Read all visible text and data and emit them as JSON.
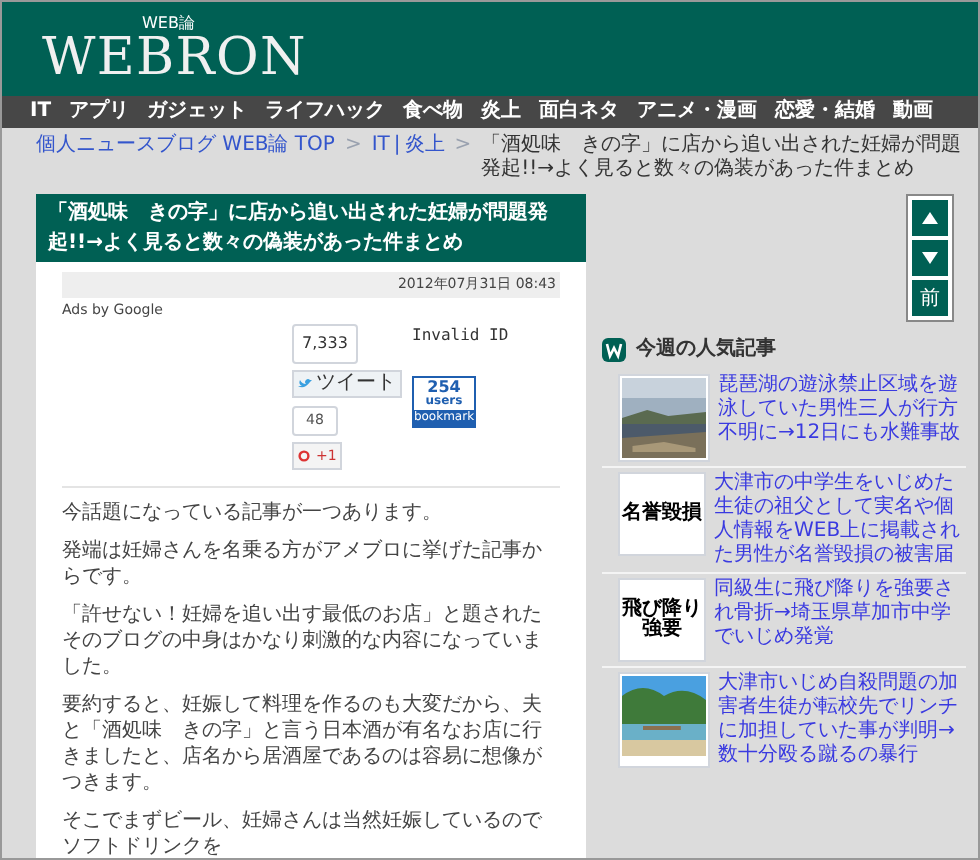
{
  "header": {
    "logo_small": "WEB論",
    "logo": "WEBRON"
  },
  "nav": [
    "IT",
    "アプリ",
    "ガジェット",
    "ライフハック",
    "食べ物",
    "炎上",
    "面白ネタ",
    "アニメ・漫画",
    "恋愛・結婚",
    "動画"
  ],
  "breadcrumb": {
    "home": "個人ニュースブログ WEB論 TOP",
    "sep": ">",
    "cat1": "IT",
    "bar": "|",
    "cat2": "炎上",
    "current": "「酒処味　きの字」に店から追い出された妊婦が問題発起!!→よく見ると数々の偽装があった件まとめ"
  },
  "article": {
    "title": "「酒処味　きの字」に店から追い出された妊婦が問題発起!!→よく見ると数々の偽装があった件まとめ",
    "date": "2012年07月31日 08:43",
    "ads": "Ads by Google",
    "share": {
      "tweet_count": "7,333",
      "tweet": "ツイート",
      "invalid": "Invalid ID",
      "plus_count": "48",
      "plus": "+1",
      "bookmark_count": "254",
      "bookmark_users": "users",
      "bookmark": "bookmark"
    },
    "paragraphs": [
      "今話題になっている記事が一つあります。",
      "発端は妊婦さんを名乗る方がアメブロに挙げた記事からです。",
      "「許せない！妊婦を追い出す最低のお店」と題されたそのブログの中身はかなり刺激的な内容になっていました。",
      "要約すると、妊娠して料理を作るのも大変だから、夫と「酒処味　きの字」と言う日本酒が有名なお店に行きましたと、店名から居酒屋であるのは容易に想像がつきます。",
      "そこでまずビール、妊婦さんは当然妊娠しているのでソフトドリンクを"
    ]
  },
  "page_nav": [
    {
      "kind": "up"
    },
    {
      "kind": "down"
    },
    {
      "kind": "text",
      "label": "前"
    }
  ],
  "popular": {
    "title": "今週の人気記事",
    "items": [
      {
        "kind": "picture",
        "text": "琵琶湖の遊泳禁止区域を遊泳していた男性三人が行方不明に→12日にも水難事故"
      },
      {
        "kind": "text",
        "thumb_text": "名誉毀損",
        "text": "大津市の中学生をいじめた生徒の祖父として実名や個人情報をWEB上に掲載された男性が名誉毀損の被害届"
      },
      {
        "kind": "text",
        "thumb_text": "飛び降り強要",
        "text": "同級生に飛び降りを強要され骨折→埼玉県草加市中学でいじめ発覚"
      },
      {
        "kind": "picture",
        "text": "大津市いじめ自殺問題の加害者生徒が転校先でリンチに加担していた事が判明→数十分殴る蹴るの暴行"
      }
    ]
  }
}
